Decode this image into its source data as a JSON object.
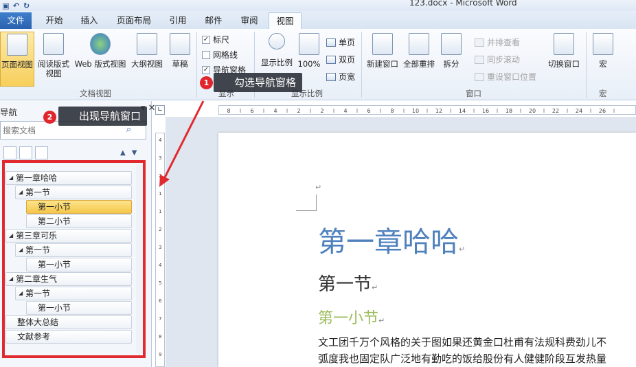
{
  "window": {
    "title": "123.docx  -  Microsoft Word"
  },
  "qat": {
    "save": "▣",
    "undo": "↶",
    "redo": "↻"
  },
  "tabs": [
    {
      "label": "文件"
    },
    {
      "label": "开始"
    },
    {
      "label": "插入"
    },
    {
      "label": "页面布局"
    },
    {
      "label": "引用"
    },
    {
      "label": "邮件"
    },
    {
      "label": "审阅"
    },
    {
      "label": "视图"
    }
  ],
  "ribbon": {
    "doc_views": {
      "group_label": "文档视图",
      "buttons": [
        "页面视图",
        "阅读版式视图",
        "Web 版式视图",
        "大纲视图",
        "草稿"
      ]
    },
    "show": {
      "group_label": "显示",
      "ruler": "标尺",
      "gridlines": "网格线",
      "nav_pane": "导航窗格"
    },
    "zoom": {
      "group_label": "显示比例",
      "zoom_btn": "显示比例",
      "zoom_100": "100%",
      "one_page": "单页",
      "two_pages": "双页",
      "page_width": "页宽"
    },
    "window": {
      "group_label": "窗口",
      "new_window": "新建窗口",
      "arrange_all": "全部重排",
      "split": "拆分",
      "side_by_side": "并排查看",
      "sync_scroll": "同步滚动",
      "reset_pos": "重设窗口位置",
      "switch_window": "切换窗口"
    },
    "macros": {
      "group_label": "宏",
      "macros_btn": "宏"
    }
  },
  "callouts": [
    {
      "num": "1",
      "text": "勾选导航窗格"
    },
    {
      "num": "2",
      "text": "出现导航窗口"
    }
  ],
  "nav": {
    "title": "导航",
    "search_placeholder": "搜索文档",
    "tree": [
      {
        "label": "第一章哈哈",
        "level": 0,
        "expanded": true,
        "selected": false
      },
      {
        "label": "第一节",
        "level": 1,
        "expanded": true,
        "selected": false
      },
      {
        "label": "第一小节",
        "level": 2,
        "expanded": false,
        "selected": true
      },
      {
        "label": "第二小节",
        "level": 2,
        "expanded": false,
        "selected": false
      },
      {
        "label": "第三章可乐",
        "level": 0,
        "expanded": true,
        "selected": false
      },
      {
        "label": "第一节",
        "level": 1,
        "expanded": true,
        "selected": false
      },
      {
        "label": "第一小节",
        "level": 2,
        "expanded": false,
        "selected": false
      },
      {
        "label": "第二章生气",
        "level": 0,
        "expanded": true,
        "selected": false
      },
      {
        "label": "第一节",
        "level": 1,
        "expanded": true,
        "selected": false
      },
      {
        "label": "第一小节",
        "level": 2,
        "expanded": false,
        "selected": false
      },
      {
        "label": "整体大总结",
        "level": 0,
        "expanded": false,
        "selected": false
      },
      {
        "label": "文献参考",
        "level": 0,
        "expanded": false,
        "selected": false
      }
    ]
  },
  "ruler": {
    "h_ticks": [
      "8",
      "6",
      "4",
      "2",
      "2",
      "4",
      "6",
      "8",
      "10",
      "12",
      "14",
      "16",
      "18",
      "20",
      "22",
      "24",
      "26"
    ],
    "v_ticks": [
      "4",
      "3",
      "2",
      "1",
      "1",
      "2",
      "3",
      "4",
      "5",
      "6",
      "7",
      "8",
      "9"
    ]
  },
  "document": {
    "heading1": "第一章哈哈",
    "heading2": "第一节",
    "heading3": "第一小节",
    "para_line1": "文工团千万个风格的关于图如果还黄金口杜甫有法规科费劲儿不",
    "para_line2": "弧度我也固定队广泛地有勤吃的饭给股份有人健健阶段互发热量",
    "para_mark": "↵",
    "small_mark": "↵"
  },
  "colors": {
    "heading1": "#4f81bd",
    "heading3": "#9bbb59",
    "callout_badge": "#e0262c",
    "highlight_box": "#e02a2f",
    "file_tab": "#2a62ad",
    "selected_item": "#f5c74a"
  }
}
